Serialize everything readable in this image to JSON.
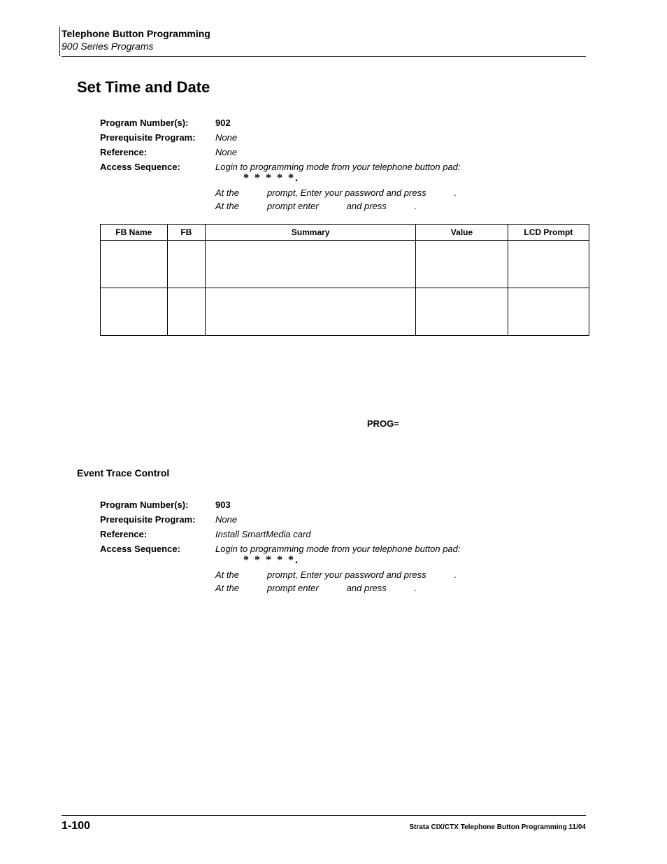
{
  "header": {
    "title": "Telephone Button Programming",
    "subtitle": "900 Series Programs"
  },
  "section1": {
    "title": "Set Time and Date",
    "prog_num_label": "Program Number(s):",
    "prog_num_value": "902",
    "prereq_label": "Prerequisite Program:",
    "prereq_value": "None",
    "ref_label": "Reference:",
    "ref_value": "None",
    "acc_label": "Access Sequence:",
    "acc_line1": "Login to programming mode from your telephone button pad:",
    "acc_stars": "* *   * * *.",
    "acc_line2_a": "At the",
    "acc_line2_b": "prompt, Enter your password and press",
    "acc_line2_c": ".",
    "acc_line3_a": "At the",
    "acc_line3_b": "prompt enter",
    "acc_line3_c": "and press",
    "acc_line3_d": "."
  },
  "table1": {
    "headers": [
      "FB Name",
      "FB",
      "Summary",
      "Value",
      "LCD Prompt"
    ]
  },
  "prog_eq": "PROG=",
  "section2": {
    "title": "Event Trace Control",
    "prog_num_label": "Program Number(s):",
    "prog_num_value": "903",
    "prereq_label": "Prerequisite Program:",
    "prereq_value": "None",
    "ref_label": "Reference:",
    "ref_value": "Install SmartMedia card",
    "acc_label": "Access Sequence:",
    "acc_line1": "Login to programming mode from your telephone button pad:",
    "acc_stars": "* *   * * *.",
    "acc_line2_a": "At the",
    "acc_line2_b": "prompt, Enter your password and press",
    "acc_line2_c": ".",
    "acc_line3_a": "At the",
    "acc_line3_b": "prompt enter",
    "acc_line3_c": "and press",
    "acc_line3_d": "."
  },
  "footer": {
    "page": "1-100",
    "text": "Strata CIX/CTX Telephone Button Programming  11/04"
  }
}
